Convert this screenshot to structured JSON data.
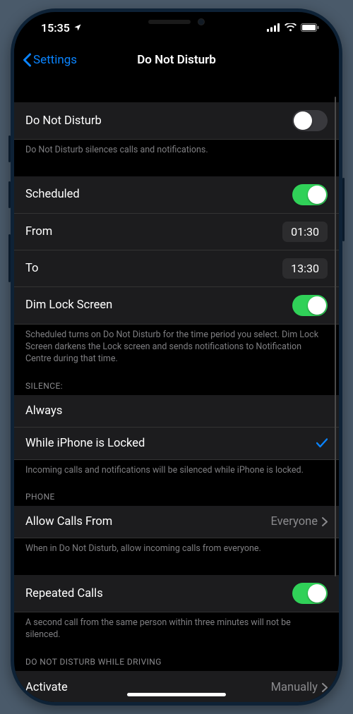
{
  "status": {
    "time": "15:35"
  },
  "nav": {
    "back": "Settings",
    "title": "Do Not Disturb"
  },
  "sections": {
    "main": {
      "dnd_label": "Do Not Disturb",
      "dnd_on": false,
      "footer": "Do Not Disturb silences calls and notifications."
    },
    "schedule": {
      "scheduled_label": "Scheduled",
      "scheduled_on": true,
      "from_label": "From",
      "from_value": "01:30",
      "to_label": "To",
      "to_value": "13:30",
      "dim_label": "Dim Lock Screen",
      "dim_on": true,
      "footer": "Scheduled turns on Do Not Disturb for the time period you select. Dim Lock Screen darkens the Lock screen and sends notifications to Notification Centre during that time."
    },
    "silence": {
      "header": "SILENCE:",
      "always": "Always",
      "while_locked": "While iPhone is Locked",
      "selected": "while_locked",
      "footer": "Incoming calls and notifications will be silenced while iPhone is locked."
    },
    "phone": {
      "header": "PHONE",
      "allow_label": "Allow Calls From",
      "allow_value": "Everyone",
      "footer": "When in Do Not Disturb, allow incoming calls from everyone."
    },
    "repeated": {
      "label": "Repeated Calls",
      "on": true,
      "footer": "A second call from the same person within three minutes will not be silenced."
    },
    "driving": {
      "header": "DO NOT DISTURB WHILE DRIVING",
      "activate_label": "Activate",
      "activate_value": "Manually"
    }
  }
}
